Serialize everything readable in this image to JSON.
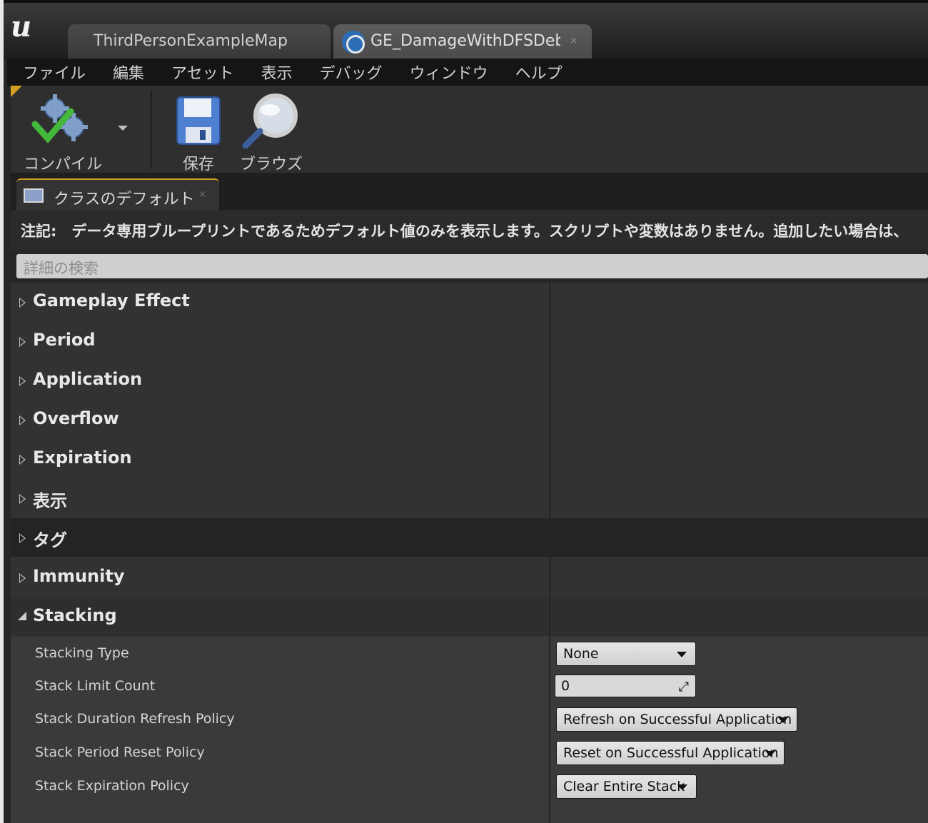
{
  "title_tabs": [
    {
      "label": "ThirdPersonExampleMap"
    },
    {
      "label": "GE_DamageWithDFSDebuff",
      "close": "×"
    }
  ],
  "menu": [
    "ファイル",
    "編集",
    "アセット",
    "表示",
    "デバッグ",
    "ウィンドウ",
    "ヘルプ"
  ],
  "toolbar": {
    "compile_label": "コンパイル",
    "save_label": "保存",
    "browse_label": "ブラウズ"
  },
  "panel": {
    "tab_label": "クラスのデフォルト",
    "tab_close": "×",
    "notice": "注記:　データ専用ブループリントであるためデフォルト値のみを表示します。スクリプトや変数はありません。追加したい場合は、",
    "search_placeholder": "詳細の検索"
  },
  "categories": [
    {
      "label": "Gameplay Effect"
    },
    {
      "label": "Period"
    },
    {
      "label": "Application"
    },
    {
      "label": "Overflow"
    },
    {
      "label": "Expiration"
    },
    {
      "label": "表示"
    },
    {
      "label": "タグ"
    },
    {
      "label": "Immunity"
    },
    {
      "label": "Stacking"
    }
  ],
  "stacking": {
    "properties": [
      {
        "label": "Stacking Type",
        "value": "None"
      },
      {
        "label": "Stack Limit Count",
        "value": "0"
      },
      {
        "label": "Stack Duration Refresh Policy",
        "value": "Refresh on Successful Application"
      },
      {
        "label": "Stack Period Reset Policy",
        "value": "Reset on Successful Application"
      },
      {
        "label": "Stack Expiration Policy",
        "value": "Clear Entire Stack"
      }
    ]
  },
  "colors": {
    "accent": "#d1a020",
    "panel_bg": "#323232",
    "highlight_row": "#242424",
    "combo_bg": "#dcdcdc"
  }
}
